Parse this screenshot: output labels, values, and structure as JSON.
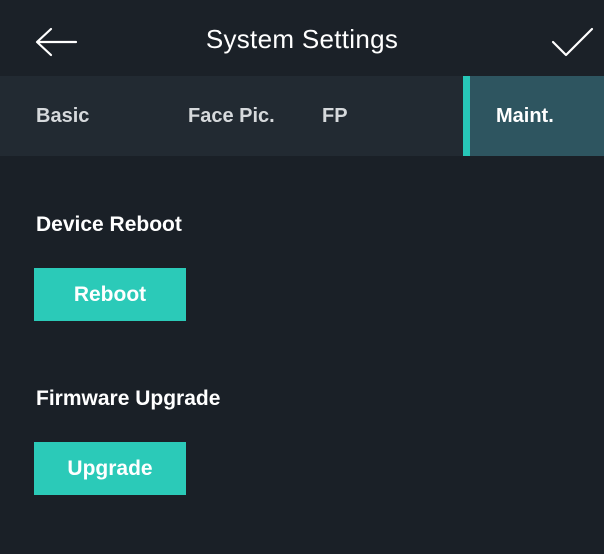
{
  "header": {
    "title": "System Settings",
    "back_icon": "arrow-left-icon",
    "confirm_icon": "checkmark-icon"
  },
  "tabs": [
    {
      "label": "Basic",
      "active": false
    },
    {
      "label": "Face Pic.",
      "active": false
    },
    {
      "label": "FP",
      "active": false
    },
    {
      "label": "Maint.",
      "active": true
    }
  ],
  "sections": {
    "reboot": {
      "title": "Device Reboot",
      "button_label": "Reboot"
    },
    "upgrade": {
      "title": "Firmware Upgrade",
      "button_label": "Upgrade"
    }
  },
  "colors": {
    "background": "#1a2027",
    "tabbar": "#222a32",
    "active_tab": "#2e5560",
    "accent": "#2bcab8"
  }
}
